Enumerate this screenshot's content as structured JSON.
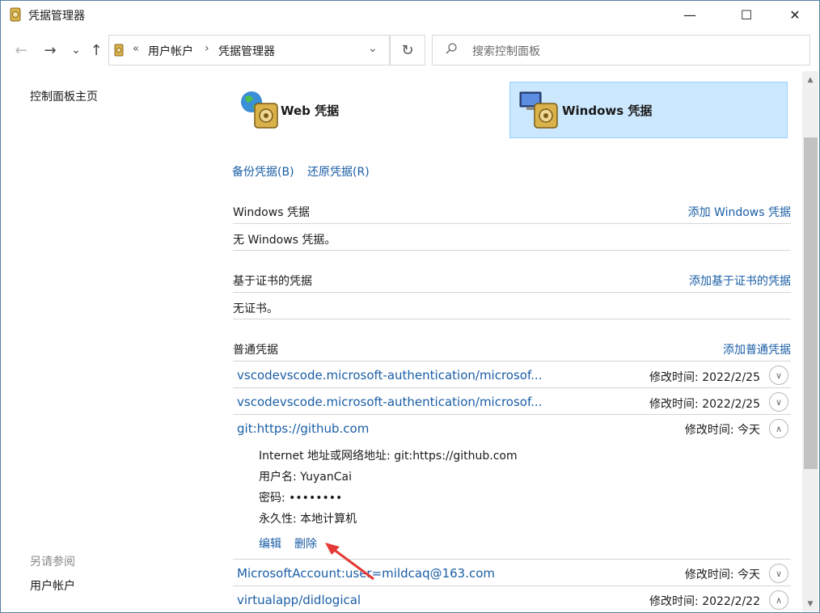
{
  "window": {
    "title": "凭据管理器",
    "buttons": {
      "minimize": "—",
      "maximize": "☐",
      "close": "✕"
    }
  },
  "nav": {
    "back": "←",
    "forward": "→",
    "recent": "⌄",
    "up": "↑",
    "refresh": "↻"
  },
  "address": {
    "chevron": "«",
    "crumbs": [
      "用户帐户",
      "凭据管理器"
    ],
    "separator": "›",
    "dropdown": "⌄"
  },
  "search": {
    "placeholder": "搜索控制面板"
  },
  "sidebar": {
    "home": "控制面板主页",
    "see_also": "另请参阅",
    "user_accounts": "用户帐户"
  },
  "tiles": {
    "web": {
      "label": "Web 凭据",
      "icon": "web-credential-vault-icon"
    },
    "windows": {
      "label": "Windows 凭据",
      "icon": "windows-credential-vault-icon",
      "selected": true
    }
  },
  "actions": {
    "backup": "备份凭据(B)",
    "restore": "还原凭据(R)"
  },
  "sections": {
    "windows": {
      "title": "Windows 凭据",
      "add": "添加 Windows 凭据",
      "empty": "无 Windows 凭据。"
    },
    "certificate": {
      "title": "基于证书的凭据",
      "add": "添加基于证书的凭据",
      "empty": "无证书。"
    },
    "generic": {
      "title": "普通凭据",
      "add": "添加普通凭据"
    }
  },
  "credentials": [
    {
      "name": "vscodevscode.microsoft-authentication/microsof...",
      "modified": "修改时间:  2022/2/25",
      "expanded": false
    },
    {
      "name": "vscodevscode.microsoft-authentication/microsof...",
      "modified": "修改时间:  2022/2/25",
      "expanded": false
    },
    {
      "name": "git:https://github.com",
      "modified": "修改时间:  今天",
      "expanded": true
    },
    {
      "name": "MicrosoftAccount:user=mildcaq@163.com",
      "modified": "修改时间:  今天",
      "expanded": false
    },
    {
      "name": "virtualapp/didlogical",
      "modified": "修改时间:  2022/2/22",
      "expanded": false
    }
  ],
  "expanded_detail": {
    "address": "Internet 地址或网络地址:  git:https://github.com",
    "username": "用户名:  YuyanCai",
    "password": "密码:  ••••••••",
    "persistence": "永久性:  本地计算机",
    "edit": "编辑",
    "delete": "删除"
  },
  "expander_glyphs": {
    "collapsed": "∨",
    "expanded": "∧"
  },
  "colors": {
    "link": "#1a5ea6",
    "selected_tile": "#cce8ff",
    "annotation_arrow": "#e53935"
  }
}
